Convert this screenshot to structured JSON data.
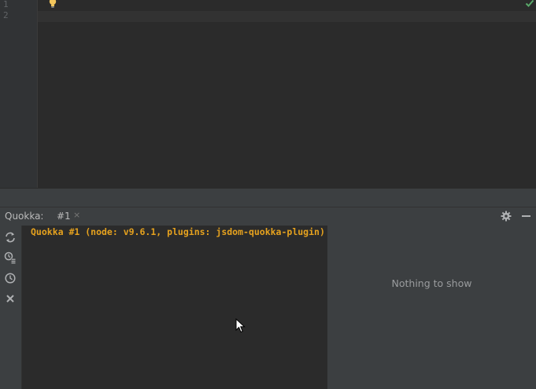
{
  "editor": {
    "line_numbers": [
      "1",
      "2"
    ]
  },
  "tool_window": {
    "title": "Quokka:",
    "tab": {
      "label": "#1",
      "close": "×"
    }
  },
  "console": {
    "output": "Quokka #1 (node: v9.6.1, plugins: jsdom-quokka-plugin)",
    "output_color": "#e6a21e"
  },
  "values_panel": {
    "empty_message": "Nothing to show"
  },
  "icons": {
    "gutter": [
      "lightbulb-icon",
      "checkmark-icon"
    ],
    "header": [
      "gear-icon",
      "minimize-icon"
    ],
    "toolbar": [
      "refresh-icon",
      "coverage-icon",
      "history-icon",
      "close-icon"
    ]
  },
  "colors": {
    "editor_bg": "#2b2b2b",
    "panel_bg": "#3c3f41",
    "accent_orange": "#e6a21e",
    "check_green": "#59a869"
  }
}
